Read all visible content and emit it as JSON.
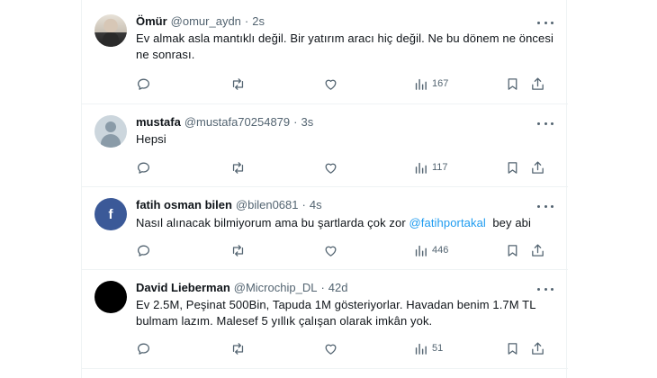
{
  "posts": [
    {
      "name": "Ömür",
      "handle": "@omur_aydn",
      "time": "2s",
      "text": "Ev almak asla mantıklı değil. Bir yatırım aracı hiç değil. Ne bu dönem ne öncesi ne sonrası.",
      "views": "167",
      "avatar": "photo"
    },
    {
      "name": "mustafa",
      "handle": "@mustafa70254879",
      "time": "3s",
      "text": "Hepsi",
      "views": "117",
      "avatar": "default-avatar-icon"
    },
    {
      "name": "fatih osman bilen",
      "handle": "@bilen0681",
      "time": "4s",
      "text_before": "Nasıl alınacak bilmiyorum ama bu şartlarda çok zor ",
      "mention": "@fatihportakal",
      "text_after": "  bey abi",
      "views": "446",
      "avatar_letter": "f",
      "avatar_color": "#3b5998"
    },
    {
      "name": "David Lieberman",
      "handle": "@Microchip_DL",
      "time": "42d",
      "text": "Ev 2.5M, Peşinat 500Bin, Tapuda 1M gösteriyorlar. Havadan benim 1.7M TL bulmam lazım. Malesef 5 yıllık çalışan olarak imkân yok.",
      "views": "51",
      "avatar": "black"
    }
  ],
  "separator": "·",
  "colors": {
    "accent": "#1d9bf0",
    "text": "#0f1419",
    "secondary": "#536471",
    "divider": "#eff3f4"
  },
  "icons": [
    "reply-icon",
    "repost-icon",
    "like-icon",
    "views-icon",
    "bookmark-icon",
    "share-icon",
    "more-icon"
  ]
}
